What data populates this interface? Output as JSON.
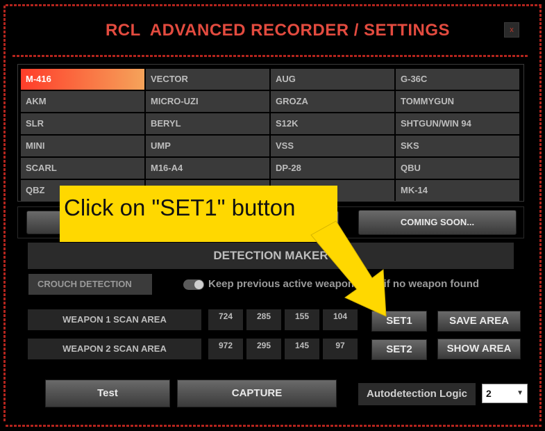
{
  "window": {
    "title": "RCL  ADVANCED RECORDER / SETTINGS",
    "close_label": "x"
  },
  "weapons": {
    "active": "M-416",
    "rows": [
      [
        "M-416",
        "VECTOR",
        "AUG",
        "G-36C"
      ],
      [
        "AKM",
        "MICRO-UZI",
        "GROZA",
        "TOMMYGUN"
      ],
      [
        "SLR",
        "BERYL",
        "S12K",
        "SHTGUN/WIN 94"
      ],
      [
        "MINI",
        "UMP",
        "VSS",
        "SKS"
      ],
      [
        "SCARL",
        "M16-A4",
        "DP-28",
        "QBU"
      ],
      [
        "QBZ",
        "",
        "",
        "MK-14"
      ]
    ]
  },
  "action_buttons": {
    "coming_soon": "COMING SOON..."
  },
  "detection": {
    "section_title": "DETECTION MAKER",
    "crouch_label": "CROUCH DETECTION",
    "keep_label": "Keep previous active weapon even if no weapon found",
    "keep_toggle_on": true,
    "areas": [
      {
        "label": "WEAPON 1 SCAN AREA",
        "values": [
          "724",
          "285",
          "155",
          "104"
        ]
      },
      {
        "label": "WEAPON 2 SCAN AREA",
        "values": [
          "972",
          "295",
          "145",
          "97"
        ]
      }
    ],
    "set1_label": "SET1",
    "set2_label": "SET2",
    "save_area_label": "SAVE AREA",
    "show_area_label": "SHOW AREA"
  },
  "bottom": {
    "test_label": "Test",
    "capture_label": "CAPTURE",
    "autodetection_label": "Autodetection Logic",
    "autodetection_value": "2"
  },
  "callout": {
    "text": "Click on \"SET1\" button"
  },
  "colors": {
    "accent_red": "#e34b3f",
    "active_gradient_start": "#ff3d2a",
    "active_gradient_end": "#f5a35a",
    "callout_yellow": "#ffd800"
  }
}
